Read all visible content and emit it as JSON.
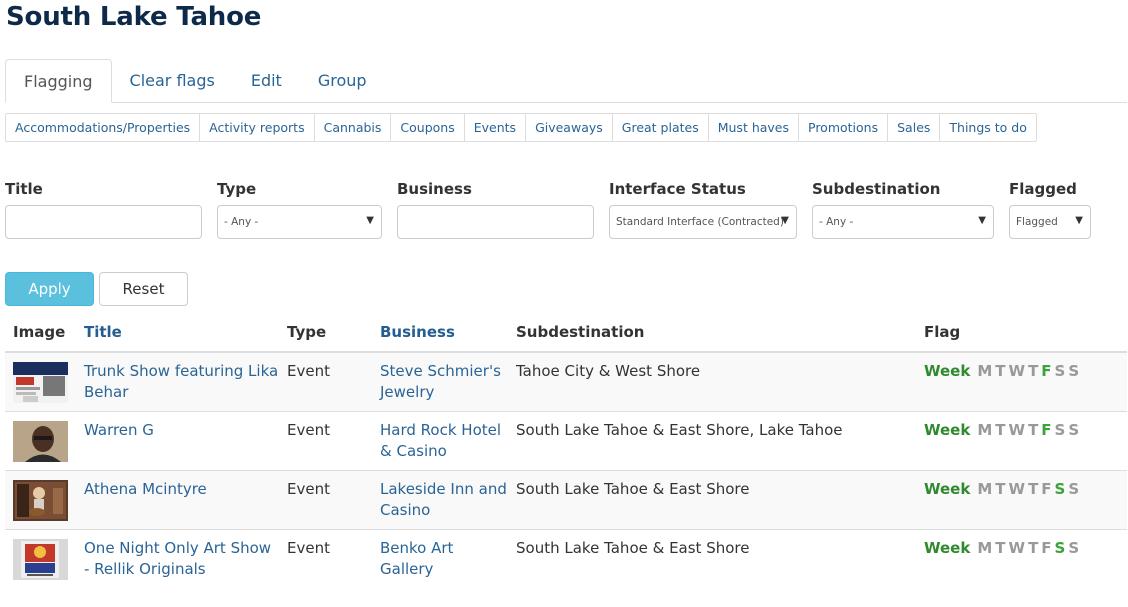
{
  "page": {
    "title": "South Lake Tahoe"
  },
  "tabs": [
    {
      "label": "Flagging",
      "active": true
    },
    {
      "label": "Clear flags",
      "active": false
    },
    {
      "label": "Edit",
      "active": false
    },
    {
      "label": "Group",
      "active": false
    }
  ],
  "subtabs": [
    "Accommodations/Properties",
    "Activity reports",
    "Cannabis",
    "Coupons",
    "Events",
    "Giveaways",
    "Great plates",
    "Must haves",
    "Promotions",
    "Sales",
    "Things to do"
  ],
  "filters": {
    "title": {
      "label": "Title",
      "value": ""
    },
    "type": {
      "label": "Type",
      "value": "- Any -"
    },
    "business": {
      "label": "Business",
      "value": ""
    },
    "interface_status": {
      "label": "Interface Status",
      "value": "Standard Interface (Contracted)"
    },
    "subdestination": {
      "label": "Subdestination",
      "value": "- Any -"
    },
    "flagged": {
      "label": "Flagged",
      "value": "Flagged"
    }
  },
  "buttons": {
    "apply": "Apply",
    "reset": "Reset"
  },
  "table": {
    "headers": {
      "image": "Image",
      "title": "Title",
      "type": "Type",
      "business": "Business",
      "subdestination": "Subdestination",
      "flag": "Flag"
    },
    "week_label": "Week",
    "day_letters": [
      "M",
      "T",
      "W",
      "T",
      "F",
      "S",
      "S"
    ],
    "rows": [
      {
        "title": "Trunk Show featuring Lika Behar",
        "type": "Event",
        "business": "Steve Schmier's Jewelry",
        "subdestination": "Tahoe City & West Shore",
        "image_icon": "trunk-show-poster",
        "days_flagged": [
          false,
          false,
          false,
          false,
          true,
          false,
          false
        ]
      },
      {
        "title": "Warren G",
        "type": "Event",
        "business": "Hard Rock Hotel & Casino",
        "subdestination": "South Lake Tahoe & East Shore, Lake Tahoe",
        "image_icon": "portrait-photo",
        "days_flagged": [
          false,
          false,
          false,
          false,
          true,
          false,
          false
        ]
      },
      {
        "title": "Athena Mcintyre",
        "type": "Event",
        "business": "Lakeside Inn and Casino",
        "subdestination": "South Lake Tahoe & East Shore",
        "image_icon": "musician-photo",
        "days_flagged": [
          false,
          false,
          false,
          false,
          false,
          true,
          false
        ]
      },
      {
        "title": "One Night Only Art Show - Rellik Originals",
        "type": "Event",
        "business": "Benko Art Gallery",
        "subdestination": "South Lake Tahoe & East Shore",
        "image_icon": "art-poster",
        "days_flagged": [
          false,
          false,
          false,
          false,
          false,
          true,
          false
        ]
      }
    ]
  },
  "colors": {
    "title": "#0d2a4a",
    "link": "#2a6496",
    "apply_button": "#5bc0de",
    "flag_week": "#2f8a2f",
    "flag_on": "#3aa33a",
    "flag_off": "#999999"
  }
}
